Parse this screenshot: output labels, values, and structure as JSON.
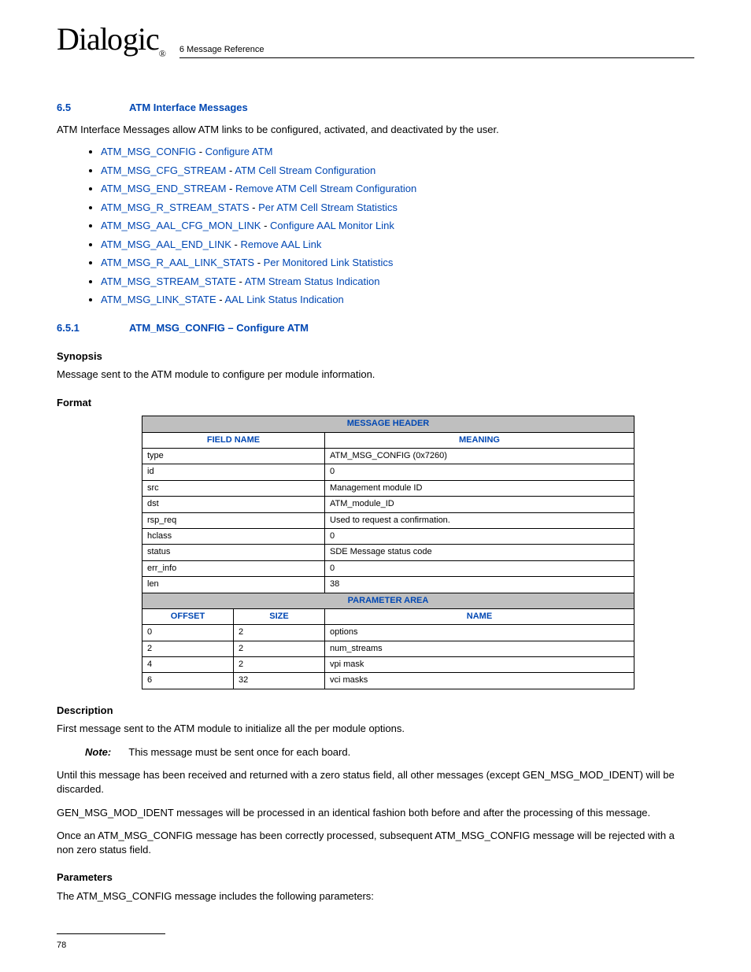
{
  "header": {
    "logo_text": "Dialogic",
    "chapter": "6 Message Reference"
  },
  "section65": {
    "number": "6.5",
    "title": "ATM Interface Messages",
    "intro": "ATM Interface Messages allow ATM links to be configured, activated, and deactivated by the user.",
    "links": [
      {
        "name": "ATM_MSG_CONFIG",
        "desc": "Configure ATM"
      },
      {
        "name": "ATM_MSG_CFG_STREAM",
        "desc": "ATM Cell Stream Configuration"
      },
      {
        "name": "ATM_MSG_END_STREAM",
        "desc": "Remove ATM Cell Stream Configuration"
      },
      {
        "name": "ATM_MSG_R_STREAM_STATS",
        "desc": "Per ATM Cell Stream Statistics"
      },
      {
        "name": "ATM_MSG_AAL_CFG_MON_LINK",
        "desc": "Configure AAL Monitor Link"
      },
      {
        "name": "ATM_MSG_AAL_END_LINK",
        "desc": "Remove AAL Link"
      },
      {
        "name": "ATM_MSG_R_AAL_LINK_STATS",
        "desc": "Per Monitored Link Statistics"
      },
      {
        "name": "ATM_MSG_STREAM_STATE",
        "desc": "ATM Stream Status Indication"
      },
      {
        "name": "ATM_MSG_LINK_STATE",
        "desc": "AAL Link Status Indication"
      }
    ]
  },
  "section651": {
    "number": "6.5.1",
    "title": "ATM_MSG_CONFIG  – Configure ATM",
    "synopsis_label": "Synopsis",
    "synopsis_text": "Message sent to the ATM module to configure per module information.",
    "format_label": "Format",
    "table": {
      "header1": "MESSAGE HEADER",
      "col_field": "FIELD NAME",
      "col_meaning": "MEANING",
      "rows": [
        {
          "f": "type",
          "m": "ATM_MSG_CONFIG (0x7260)"
        },
        {
          "f": "id",
          "m": "0"
        },
        {
          "f": "src",
          "m": "Management module ID"
        },
        {
          "f": "dst",
          "m": "ATM_module_ID"
        },
        {
          "f": "rsp_req",
          "m": "Used to request a confirmation."
        },
        {
          "f": "hclass",
          "m": "0"
        },
        {
          "f": "status",
          "m": "SDE Message status code"
        },
        {
          "f": "err_info",
          "m": "0"
        },
        {
          "f": "len",
          "m": "38"
        }
      ],
      "header2": "PARAMETER AREA",
      "col_offset": "OFFSET",
      "col_size": "SIZE",
      "col_name": "NAME",
      "prows": [
        {
          "o": "0",
          "s": "2",
          "n": "options"
        },
        {
          "o": "2",
          "s": "2",
          "n": "num_streams"
        },
        {
          "o": "4",
          "s": "2",
          "n": "vpi mask"
        },
        {
          "o": "6",
          "s": "32",
          "n": "vci masks"
        }
      ]
    },
    "description_label": "Description",
    "desc1": "First message sent to the ATM module to initialize all the per module options.",
    "note_label": "Note:",
    "note_text": "This message must be sent once for each board.",
    "desc2": "Until this message has been received and returned with a zero status field, all other messages (except GEN_MSG_MOD_IDENT) will be discarded.",
    "desc3": "GEN_MSG_MOD_IDENT messages will be processed in an identical fashion both before and after the processing of this message.",
    "desc4": "Once an ATM_MSG_CONFIG message has been correctly processed, subsequent ATM_MSG_CONFIG message will be rejected with a non zero status field.",
    "parameters_label": "Parameters",
    "parameters_text": "The ATM_MSG_CONFIG message includes the following parameters:"
  },
  "footer": {
    "page": "78"
  }
}
